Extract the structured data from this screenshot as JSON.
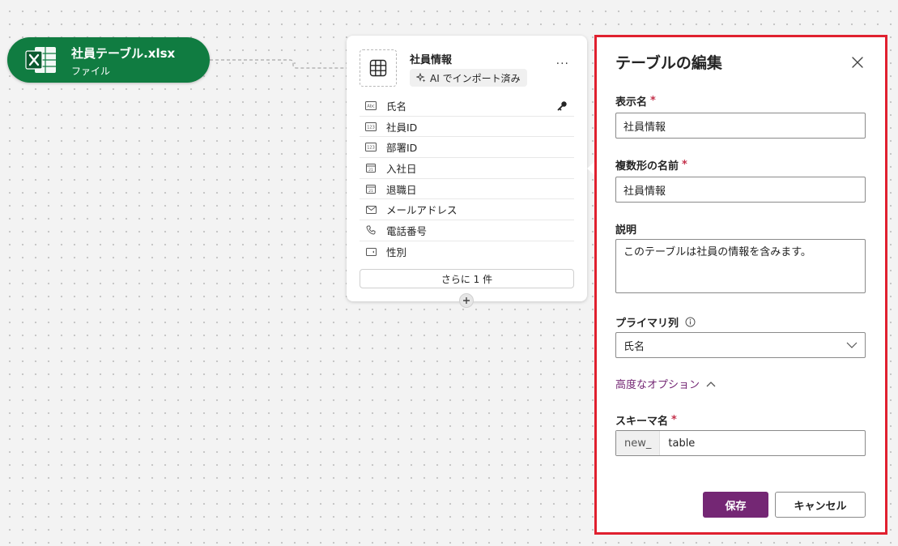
{
  "source_node": {
    "title": "社員テーブル.xlsx",
    "subtitle": "ファイル",
    "icon": "excel-icon",
    "color": "#107c41"
  },
  "entity_card": {
    "title": "社員情報",
    "badge": "AI でインポート済み",
    "more_label": "···",
    "columns": [
      {
        "label": "氏名",
        "icon": "text-column-icon",
        "primary": true
      },
      {
        "label": "社員ID",
        "icon": "number-column-icon"
      },
      {
        "label": "部署ID",
        "icon": "number-column-icon"
      },
      {
        "label": "入社日",
        "icon": "date-column-icon"
      },
      {
        "label": "退職日",
        "icon": "date-column-icon"
      },
      {
        "label": "メールアドレス",
        "icon": "email-column-icon"
      },
      {
        "label": "電話番号",
        "icon": "phone-column-icon"
      },
      {
        "label": "性別",
        "icon": "choice-column-icon"
      }
    ],
    "more_columns_label": "さらに 1 件"
  },
  "edit_panel": {
    "title": "テーブルの編集",
    "display_name": {
      "label": "表示名",
      "required_mark": "*",
      "value": "社員情報"
    },
    "plural_name": {
      "label": "複数形の名前",
      "required_mark": "*",
      "value": "社員情報"
    },
    "description": {
      "label": "説明",
      "value": "このテーブルは社員の情報を含みます。"
    },
    "primary_column": {
      "label": "プライマリ列",
      "info_icon": "info-icon",
      "value": "氏名"
    },
    "advanced_options_label": "高度なオプション",
    "schema_name": {
      "label": "スキーマ名",
      "required_mark": "*",
      "prefix": "new_",
      "value": "table"
    },
    "save_label": "保存",
    "cancel_label": "キャンセル"
  },
  "colors": {
    "accent": "#742774",
    "highlight_border": "#e0202f",
    "required": "#c4314b"
  }
}
